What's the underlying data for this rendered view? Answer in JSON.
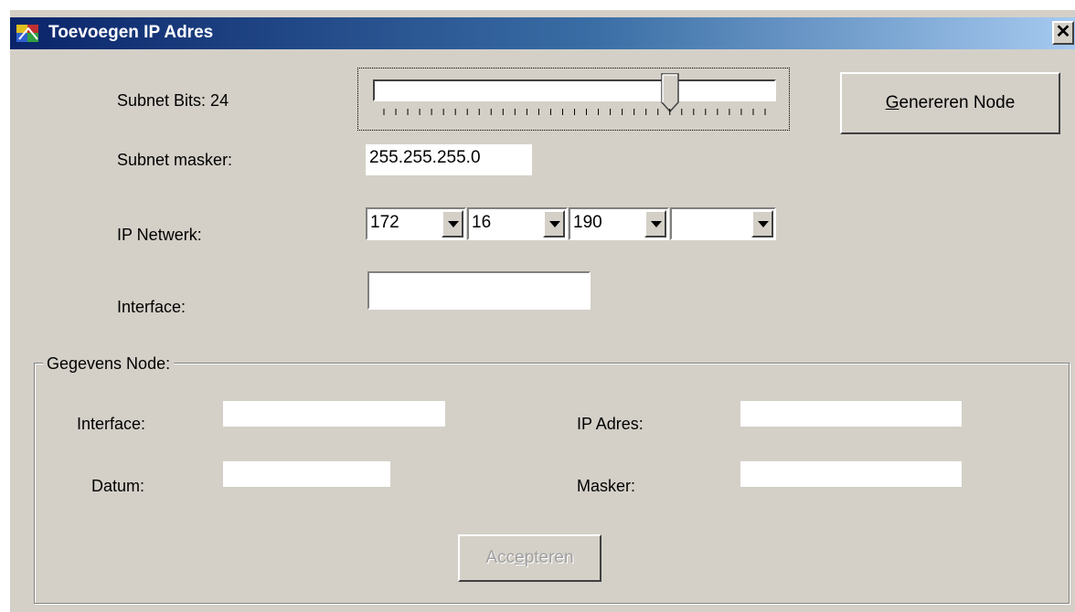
{
  "window": {
    "title": "Toevoegen IP Adres",
    "close_symbol": "✕"
  },
  "subnet": {
    "bits_label": "Subnet Bits: 24",
    "slider_value_bits": 24,
    "mask_label": "Subnet masker:",
    "mask_value": "255.255.255.0"
  },
  "network": {
    "label": "IP Netwerk:",
    "octets": [
      "172",
      "16",
      "190",
      ""
    ]
  },
  "interface": {
    "label": "Interface:",
    "value": ""
  },
  "buttons": {
    "generate_prefix": "",
    "generate_accel": "G",
    "generate_rest": "enereren Node",
    "accept_prefix": "Acc",
    "accept_accel": "e",
    "accept_rest": "pteren"
  },
  "node_group": {
    "legend": "Gegevens Node:",
    "interface_label": "Interface:",
    "date_label": "Datum:",
    "ip_label": "IP Adres:",
    "mask_label": "Masker:",
    "interface_value": "",
    "date_value": "",
    "ip_value": "",
    "mask_value": ""
  },
  "icons": {
    "app": "app-icon",
    "slider": "slider-thumb-icon",
    "dropdown": "chevron-down-icon"
  }
}
